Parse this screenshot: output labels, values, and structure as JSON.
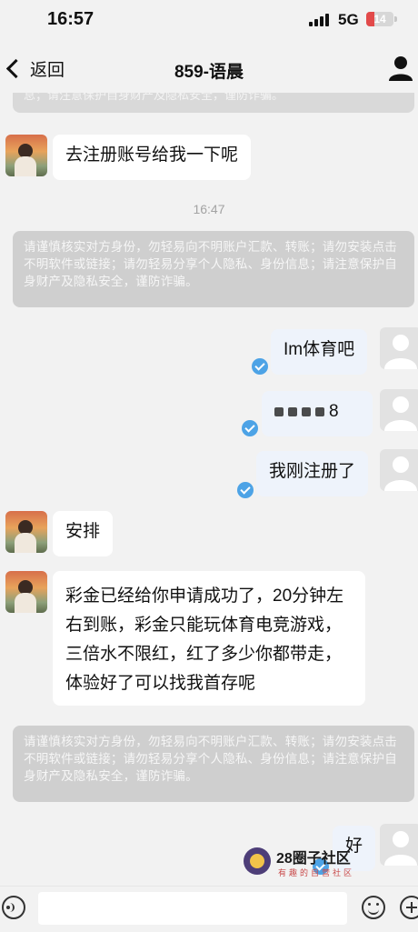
{
  "status_bar": {
    "time": "16:57",
    "network": "5G",
    "battery": "14"
  },
  "header": {
    "back_label": "返回",
    "title": "859-语晨"
  },
  "timestamp": "16:47",
  "notice_partial": "息；请注意保护自身财产及隐私安全，谨防诈骗。",
  "notice_text": "请谨慎核实对方身份，勿轻易向不明账户汇款、转账；请勿安装点击不明软件或链接；请勿轻易分享个人隐私、身份信息；请注意保护自身财产及隐私安全，谨防诈骗。",
  "messages": [
    {
      "side": "in",
      "text": "去注册账号给我一下呢"
    },
    {
      "side": "out",
      "text": "Im体育吧"
    },
    {
      "side": "out",
      "text": "8"
    },
    {
      "side": "out",
      "text": "我刚注册了"
    },
    {
      "side": "in",
      "text": "安排"
    },
    {
      "side": "in",
      "text": "彩金已经给你申请成功了，20分钟左右到账，彩金只能玩体育电竞游戏，三倍水不限红，红了多少你都带走，体验好了可以找我首存呢"
    },
    {
      "side": "out",
      "text": "好"
    }
  ],
  "watermark": {
    "title": "28圈子社区",
    "subtitle": "有趣的自营社区"
  },
  "input": {
    "placeholder": ""
  },
  "colors": {
    "background": "#f2f2f2",
    "incoming_bubble": "#ffffff",
    "outgoing_bubble": "#eef3fb",
    "notice": "#cfcfcf",
    "read_check": "#4da3e6",
    "battery_low": "#e24a4a"
  }
}
